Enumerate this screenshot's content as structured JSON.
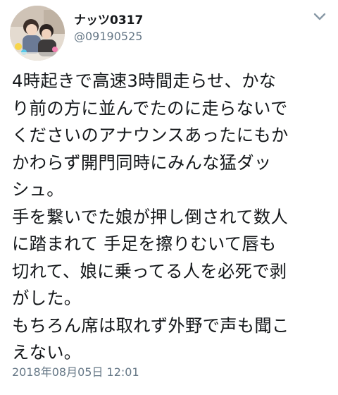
{
  "tweet": {
    "author": {
      "display_name": "ナッツ0317",
      "handle": "@09190525",
      "avatar_icon": "profile-photo"
    },
    "menu_icon": "chevron-down-icon",
    "text_lines": [
      "4時起きで高速3時間走らせ、かな",
      "り前の方に並んでたのに走らないで",
      "くださいのアナウンスあったにもか",
      "かわらず開門同時にみんな猛ダッ",
      "シュ。",
      "手を繋いでた娘が押し倒されて数人",
      "に踏まれて 手足を擦りむいて唇も",
      "切れて、娘に乗ってる人を必死で剥",
      "がした。",
      "もちろん席は取れず外野で声も聞こ",
      "えない。"
    ],
    "timestamp": "2018年08月05日 12:01",
    "colors": {
      "text": "#14171a",
      "secondary": "#657786",
      "background": "#ffffff"
    }
  }
}
